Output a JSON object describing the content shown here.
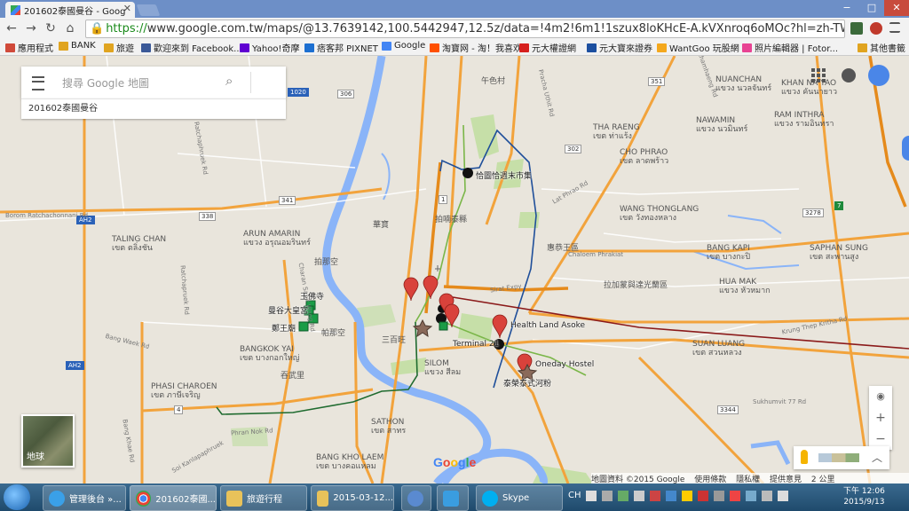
{
  "browser": {
    "tab_title": "201602泰國曼谷 - Goog",
    "tab_close": "✕",
    "window_controls": [
      "−",
      "□",
      "✕"
    ],
    "nav": {
      "back": "←",
      "forward": "→",
      "reload": "↻",
      "home": "⌂"
    },
    "url_secure": "https://",
    "url_rest": "www.google.com.tw/maps/@13.7639142,100.5442947,12.5z/data=!4m2!6m1!1szux8loKHcE-A.kVXnroq6oMOc?hl=zh-TW",
    "star": "☆"
  },
  "bookmarks": [
    {
      "label": "應用程式",
      "color": "#d04a3a"
    },
    {
      "label": "BANK",
      "color": "#e0a420"
    },
    {
      "label": "旅遊",
      "color": "#e0a420"
    },
    {
      "label": "歡迎來到 Facebook...",
      "color": "#3b5998"
    },
    {
      "label": "Yahoo!奇摩",
      "color": "#6001d2"
    },
    {
      "label": "痞客邦 PIXNET",
      "color": "#1c6fd1"
    },
    {
      "label": "Google",
      "color": "#4285f4"
    },
    {
      "label": "淘寶网 - 淘！我喜欢",
      "color": "#ff5000"
    },
    {
      "label": "元大權證網",
      "color": "#d6201e"
    },
    {
      "label": "元大寶來證券",
      "color": "#1c4fa0"
    },
    {
      "label": "WantGoo 玩股網",
      "color": "#f4a81d"
    },
    {
      "label": "照片編輯器 | Fotor...",
      "color": "#e84393"
    }
  ],
  "bookmarks_other": "其他書籤",
  "search": {
    "placeholder": "搜尋 Google 地圖",
    "icon": "search-icon"
  },
  "map_name": "201602泰國曼谷",
  "map_places": [
    {
      "name": "恰圖恰週末市集",
      "kind": "dot"
    },
    {
      "name": "玉佛寺",
      "kind": "green"
    },
    {
      "name": "曼谷大皇宮",
      "kind": "green"
    },
    {
      "name": "鄭王廟",
      "kind": "green"
    },
    {
      "name": "Health Land Asoke",
      "kind": "pin"
    },
    {
      "name": "Terminal 21",
      "kind": "dot"
    },
    {
      "name": "Oneday Hostel",
      "kind": "pin"
    },
    {
      "name": "泰榮泰式河粉",
      "kind": "star"
    }
  ],
  "districts": [
    {
      "en": "NUANCHAN",
      "th": "แขวง นวลจันทร์"
    },
    {
      "en": "RAM INTHRA",
      "th": "แขวง รามอินทรา"
    },
    {
      "en": "NAWAMIN",
      "th": "แขวง นวมินทร์"
    },
    {
      "en": "KHAN NA YAO",
      "th": "แขวง คันนายาว"
    },
    {
      "en": "THA RAENG",
      "th": "เขต ท่าแร้ง"
    },
    {
      "en": "CHO PHRAO",
      "th": "เขต ลาดพร้าว"
    },
    {
      "en": "WANG THONGLANG",
      "th": "เขต วังทองหลาง"
    },
    {
      "en": "BANG KAPI",
      "th": "เขต บางกะปิ"
    },
    {
      "en": "SAPHAN SUNG",
      "th": "เขต สะพานสูง"
    },
    {
      "en": "HUA MAK",
      "th": "แขวง หัวหมาก"
    },
    {
      "en": "SUAN LUANG",
      "th": "เขต สวนหลวง"
    },
    {
      "en": "TALING CHAN",
      "th": "เขต ตลิ่งชัน"
    },
    {
      "en": "ARUN AMARIN",
      "th": "แขวง อรุณอมรินทร์"
    },
    {
      "en": "BANGKOK YAI",
      "th": "เขต บางกอกใหญ่"
    },
    {
      "en": "PHASI CHAROEN",
      "th": "เขต ภาษีเจริญ"
    },
    {
      "en": "SATHON",
      "th": "เขต สาทร"
    },
    {
      "en": "BANG KHO LAEM",
      "th": "เขต บางคอแหลม"
    },
    {
      "en": "SILOM",
      "th": "แขวง สีลม"
    }
  ],
  "zh_labels": [
    "午色村",
    "拍喃泰縣",
    "華寶",
    "拍那空",
    "惠恭王區",
    "拉加蒙與達光蘭區",
    "三百旺",
    "吞武里",
    "帕那空"
  ],
  "road_labels": [
    "Ramkhamhaeng Rd",
    "Ratchaphruek Rd",
    "Ratchapruek Rd",
    "Bang Waek Rd",
    "Sirat Expy",
    "Krung Thep Kritha Rd",
    "Sukhumvit 77 Rd",
    "Borom Ratchachonnani Rd",
    "Chaloem Phrakiat",
    "Phran Nok Rd",
    "Charan Sanit Wong Rd",
    "Lat Phrao Rd",
    "Pracha Uthit Rd",
    "Bang Khae Rd",
    "Soi Kanlapaphruek"
  ],
  "shields": [
    {
      "text": "306",
      "style": "white"
    },
    {
      "text": "351",
      "style": "white"
    },
    {
      "text": "302",
      "style": "white"
    },
    {
      "text": "341",
      "style": "white"
    },
    {
      "text": "338",
      "style": "white"
    },
    {
      "text": "AH2",
      "style": "blue"
    },
    {
      "text": "3278",
      "style": "white"
    },
    {
      "text": "1",
      "style": "white"
    },
    {
      "text": "4",
      "style": "white"
    },
    {
      "text": "3344",
      "style": "white"
    },
    {
      "text": "1020",
      "style": "blue"
    },
    {
      "text": "7",
      "style": "green"
    }
  ],
  "layers_button": "地球",
  "zoom": {
    "locate": "◉",
    "in": "+",
    "out": "−"
  },
  "pegman_chevron": "︿",
  "google_logo": "Google",
  "footer": {
    "data": "地圖資料 ©2015 Google",
    "terms": "使用條款",
    "privacy": "隱私權",
    "feedback": "提供意見",
    "scale": "2 公里"
  },
  "taskbar": {
    "items": [
      {
        "label": "管理後台 »..."
      },
      {
        "label": "201602泰國..."
      },
      {
        "label": "旅遊行程"
      },
      {
        "label": "2015-03-12..."
      },
      {
        "label": "Skype"
      }
    ],
    "tray_lang": "CH",
    "time": "下午 12:06",
    "date": "2015/9/13"
  }
}
